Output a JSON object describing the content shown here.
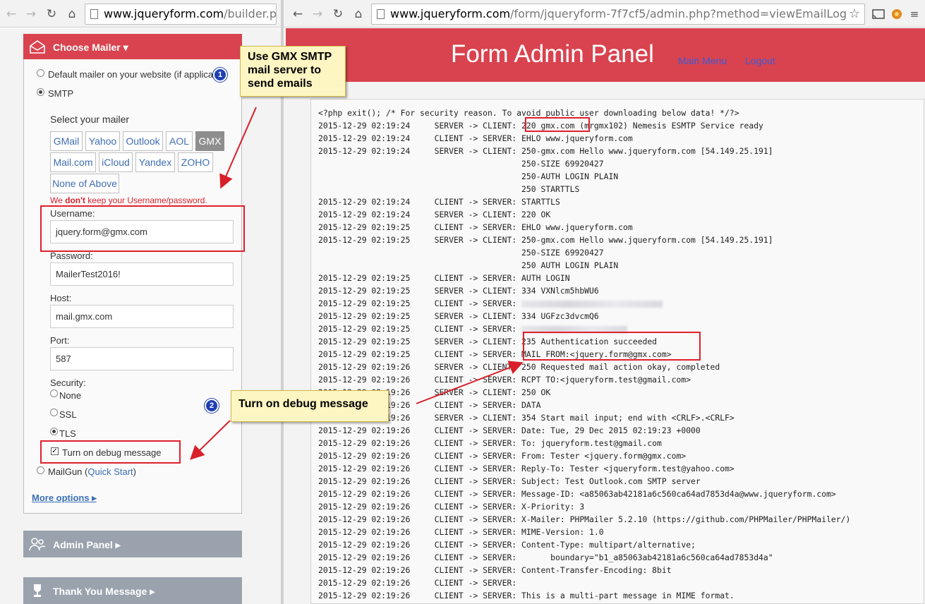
{
  "left_browser": {
    "url_host": "www.jqueryform.com",
    "url_path": "/builder.php"
  },
  "right_browser": {
    "url_host": "www.jqueryform.com",
    "url_path": "/form/jqueryform-7f7cf5/admin.php?method=viewEmailLog"
  },
  "builder": {
    "choose_mailer": "Choose Mailer",
    "default_mailer": "Default mailer on your website (if applica",
    "smtp": "SMTP",
    "select_mailer": "Select your mailer",
    "mailers": [
      "GMail",
      "Yahoo",
      "Outlook",
      "AOL",
      "GMX",
      "Mail.com",
      "iCloud",
      "Yandex",
      "ZOHO",
      "None of Above"
    ],
    "active_mailer": "GMX",
    "warning_pre": "We ",
    "warning_bold": "don't",
    "warning_post": " keep your Username/password.",
    "username_label": "Username:",
    "username_value": "jquery.form@gmx.com",
    "password_label": "Password:",
    "password_value": "MailerTest2016!",
    "host_label": "Host:",
    "host_value": "mail.gmx.com",
    "port_label": "Port:",
    "port_value": "587",
    "security_label": "Security:",
    "security_options": [
      "None",
      "SSL",
      "TLS"
    ],
    "security_selected": "TLS",
    "debug_label": "Turn on debug message",
    "debug_checked": true,
    "mailgun_label": "MailGun (",
    "mailgun_link": "Quick Start",
    "mailgun_close": ")",
    "more_options": "More options",
    "admin_panel": "Admin Panel",
    "thank_you": "Thank You Message"
  },
  "callouts": {
    "gmx": "Use GMX SMTP mail server to send emails",
    "debug": "Turn on debug message",
    "badge1": "1",
    "badge2": "2"
  },
  "admin": {
    "title": "Form Admin Panel",
    "main_menu": "Main Menu",
    "logout": "Logout"
  },
  "log_lines": [
    "<?php exit(); /* For security reason. To avoid public user downloading below data! */?>",
    "2015-12-29 02:19:24     SERVER -> CLIENT: 220 gmx.com (mrgmx102) Nemesis ESMTP Service ready",
    "2015-12-29 02:19:24     CLIENT -> SERVER: EHLO www.jqueryform.com",
    "2015-12-29 02:19:24     SERVER -> CLIENT: 250-gmx.com Hello www.jqueryform.com [54.149.25.191]",
    "                                          250-SIZE 69920427",
    "                                          250-AUTH LOGIN PLAIN",
    "                                          250 STARTTLS",
    "2015-12-29 02:19:24     CLIENT -> SERVER: STARTTLS",
    "2015-12-29 02:19:24     SERVER -> CLIENT: 220 OK",
    "2015-12-29 02:19:25     CLIENT -> SERVER: EHLO www.jqueryform.com",
    "2015-12-29 02:19:25     SERVER -> CLIENT: 250-gmx.com Hello www.jqueryform.com [54.149.25.191]",
    "                                          250-SIZE 69920427",
    "                                          250 AUTH LOGIN PLAIN",
    "2015-12-29 02:19:25     CLIENT -> SERVER: AUTH LOGIN",
    "2015-12-29 02:19:25     SERVER -> CLIENT: 334 VXNlcm5hbWU6",
    "2015-12-29 02:19:25     CLIENT -> SERVER: ",
    "2015-12-29 02:19:25     SERVER -> CLIENT: 334 UGFzc3dvcmQ6",
    "2015-12-29 02:19:25     CLIENT -> SERVER: ",
    "2015-12-29 02:19:25     SERVER -> CLIENT: 235 Authentication succeeded",
    "2015-12-29 02:19:25     CLIENT -> SERVER: MAIL FROM:<jquery.form@gmx.com>",
    "2015-12-29 02:19:26     SERVER -> CLIENT: 250 Requested mail action okay, completed",
    "2015-12-29 02:19:26     CLIENT -> SERVER: RCPT TO:<jqueryform.test@gmail.com>",
    "2015-12-29 02:19:26     SERVER -> CLIENT: 250 OK",
    "2015-12-29 02:19:26     CLIENT -> SERVER: DATA",
    "2015-12-29 02:19:26     SERVER -> CLIENT: 354 Start mail input; end with <CRLF>.<CRLF>",
    "2015-12-29 02:19:26     CLIENT -> SERVER: Date: Tue, 29 Dec 2015 02:19:23 +0000",
    "2015-12-29 02:19:26     CLIENT -> SERVER: To: jqueryform.test@gmail.com",
    "2015-12-29 02:19:26     CLIENT -> SERVER: From: Tester <jquery.form@gmx.com>",
    "2015-12-29 02:19:26     CLIENT -> SERVER: Reply-To: Tester <jqueryform.test@yahoo.com>",
    "2015-12-29 02:19:26     CLIENT -> SERVER: Subject: Test Outlook.com SMTP server",
    "2015-12-29 02:19:26     CLIENT -> SERVER: Message-ID: <a85063ab42181a6c560ca64ad7853d4a@www.jqueryform.com>",
    "2015-12-29 02:19:26     CLIENT -> SERVER: X-Priority: 3",
    "2015-12-29 02:19:26     CLIENT -> SERVER: X-Mailer: PHPMailer 5.2.10 (https://github.com/PHPMailer/PHPMailer/)",
    "2015-12-29 02:19:26     CLIENT -> SERVER: MIME-Version: 1.0",
    "2015-12-29 02:19:26     CLIENT -> SERVER: Content-Type: multipart/alternative;",
    "2015-12-29 02:19:26     CLIENT -> SERVER:       boundary=\"b1_a85063ab42181a6c560ca64ad7853d4a\"",
    "2015-12-29 02:19:26     CLIENT -> SERVER: Content-Transfer-Encoding: 8bit",
    "2015-12-29 02:19:26     CLIENT -> SERVER: ",
    "2015-12-29 02:19:26     CLIENT -> SERVER: This is a multi-part message in MIME format."
  ],
  "blurred_line_indexes": [
    15,
    17
  ],
  "colors": {
    "header_red": "#d9434f",
    "section_grey": "#9aa3ad",
    "link_blue": "#3a6fb6",
    "highlight_red": "#e0202d",
    "callout_yellow": "#fdf5c2",
    "badge_blue": "#1f3fb3"
  }
}
